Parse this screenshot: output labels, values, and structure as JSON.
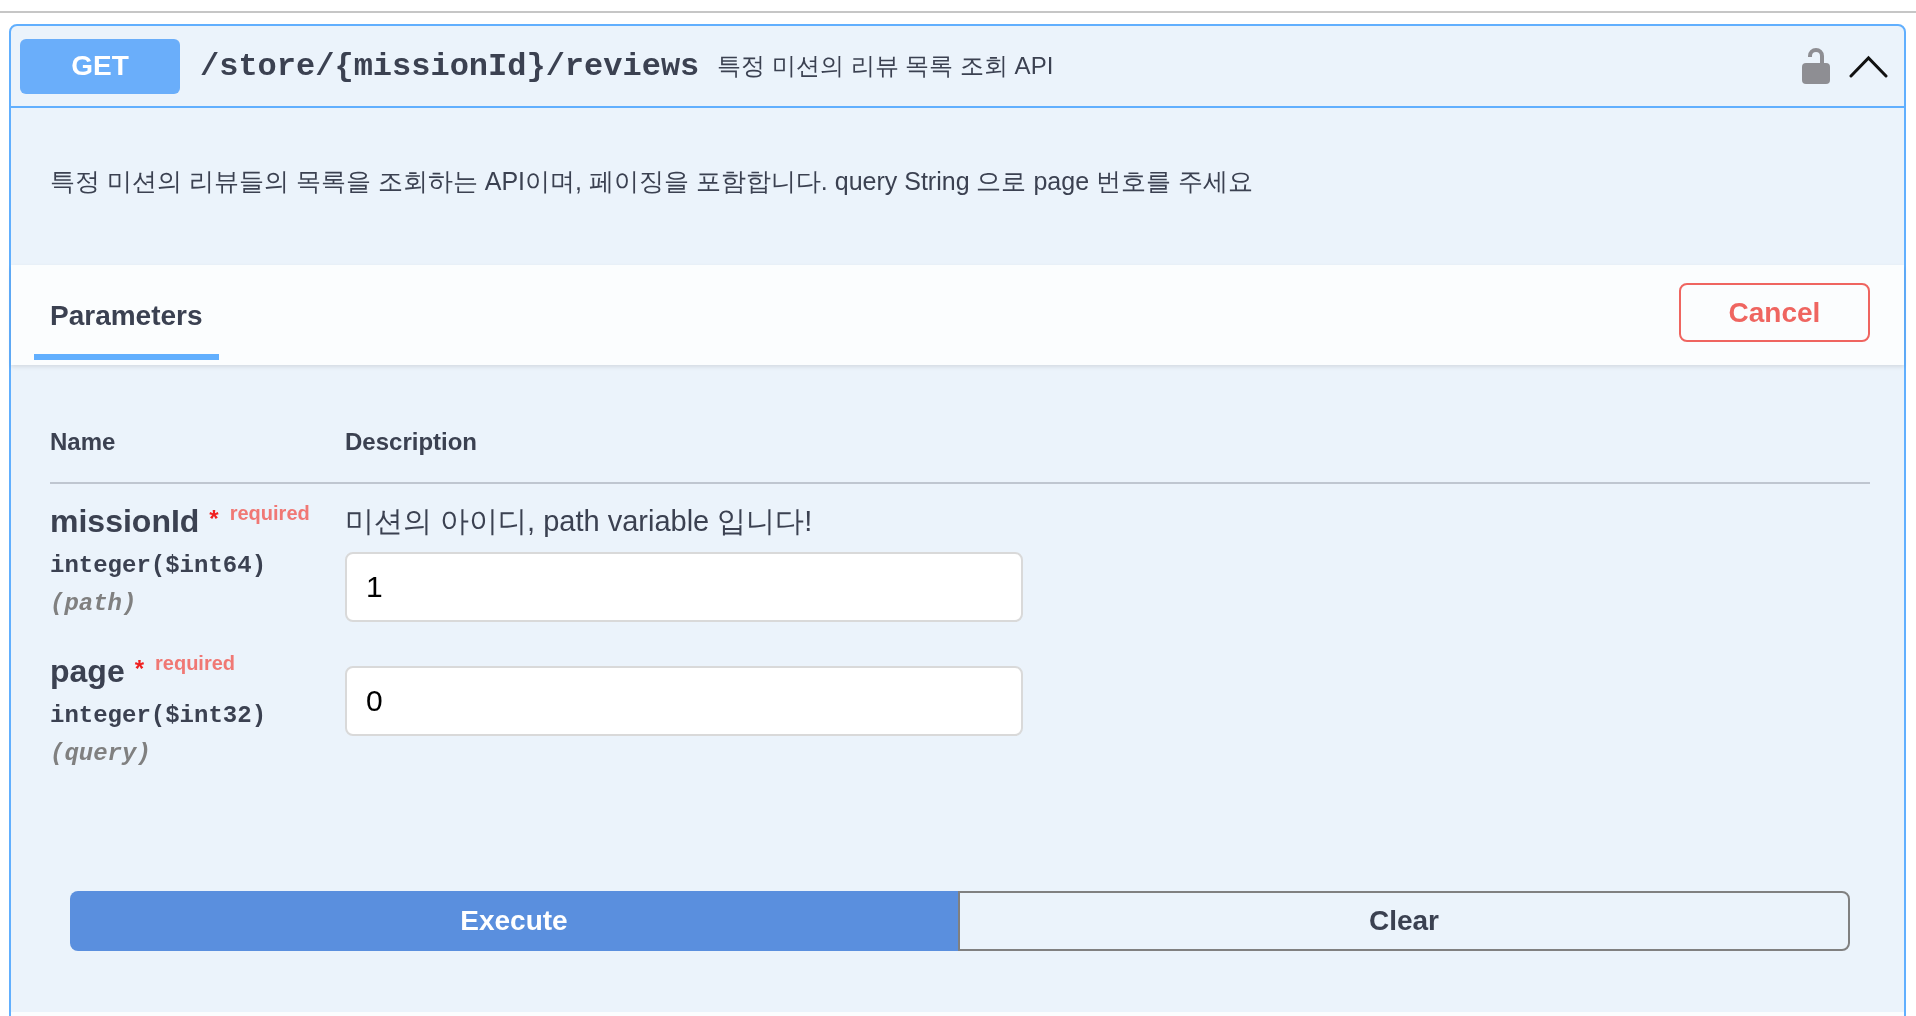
{
  "operation": {
    "method": "GET",
    "path": "/store/{missionId}/reviews",
    "summary": "특정 미션의 리뷰 목록 조회 API",
    "locked": false,
    "expanded": true
  },
  "description": "특정 미션의 리뷰들의 목록을 조회하는 API이며, 페이징을 포함합니다. query String 으로 page 번호를 주세요",
  "section": {
    "tabs": [
      {
        "label": "Parameters",
        "selected": true
      }
    ],
    "cancel_button": "Cancel"
  },
  "parameters": {
    "columns": [
      "Name",
      "Description"
    ],
    "rows": [
      {
        "name": "missionId",
        "required": true,
        "required_mark": "*",
        "required_label": "required",
        "type": "integer($int64)",
        "location": "(path)",
        "description": "미션의 아이디, path variable 입니다!",
        "value": "1"
      },
      {
        "name": "page",
        "required": true,
        "required_mark": "*",
        "required_label": "required",
        "type": "integer($int32)",
        "location": "(query)",
        "value": "0"
      }
    ]
  },
  "buttons": [
    {
      "label": "Execute",
      "kind": "primary"
    },
    {
      "label": "Clear",
      "kind": "secondary"
    }
  ]
}
